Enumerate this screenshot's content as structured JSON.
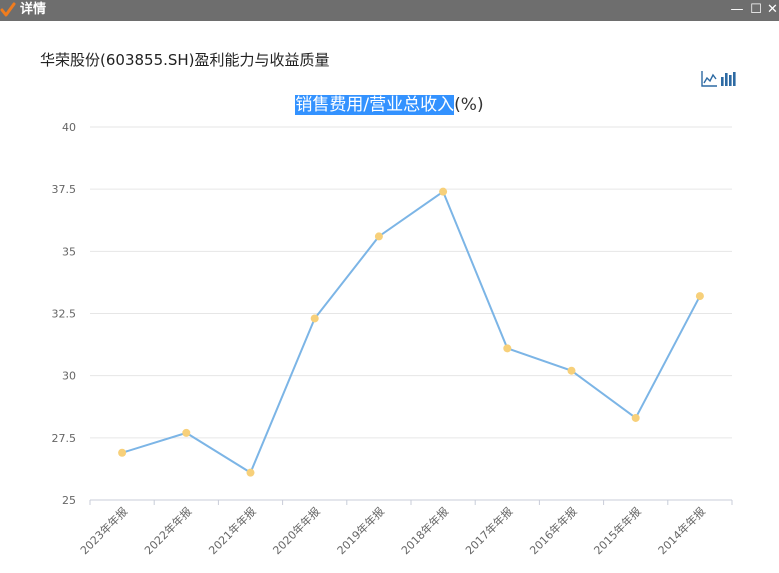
{
  "window": {
    "title": "详情",
    "controls": {
      "minimize": "—",
      "maximize": "☐",
      "close": "✕"
    }
  },
  "report": {
    "title": "华荣股份(603855.SH)盈利能力与收益质量"
  },
  "toolbar": {
    "tools": [
      {
        "name": "line-chart-toggle",
        "icon": "line-chart-icon"
      },
      {
        "name": "bar-chart-toggle",
        "icon": "bar-chart-icon"
      }
    ]
  },
  "chart_data": {
    "type": "line",
    "title_highlight": "销售费用/营业总收入",
    "title_rest": "(%)",
    "categories": [
      "2023年年报",
      "2022年年报",
      "2021年年报",
      "2020年年报",
      "2019年年报",
      "2018年年报",
      "2017年年报",
      "2016年年报",
      "2015年年报",
      "2014年年报"
    ],
    "series": [
      {
        "values": [
          26.9,
          27.7,
          26.1,
          32.3,
          35.6,
          37.4,
          31.1,
          30.2,
          28.3,
          33.2
        ]
      }
    ],
    "ylim": [
      25,
      40
    ],
    "yticks": [
      "25",
      "27.5",
      "30",
      "32.5",
      "35",
      "37.5",
      "40"
    ],
    "grid": true,
    "colors": {
      "line": "#7cb5e6",
      "marker": "#f7d07a",
      "grid": "#e6e6e6",
      "axis": "#c8ccd8",
      "label": "#666666",
      "highlight": "#3392ff"
    }
  }
}
